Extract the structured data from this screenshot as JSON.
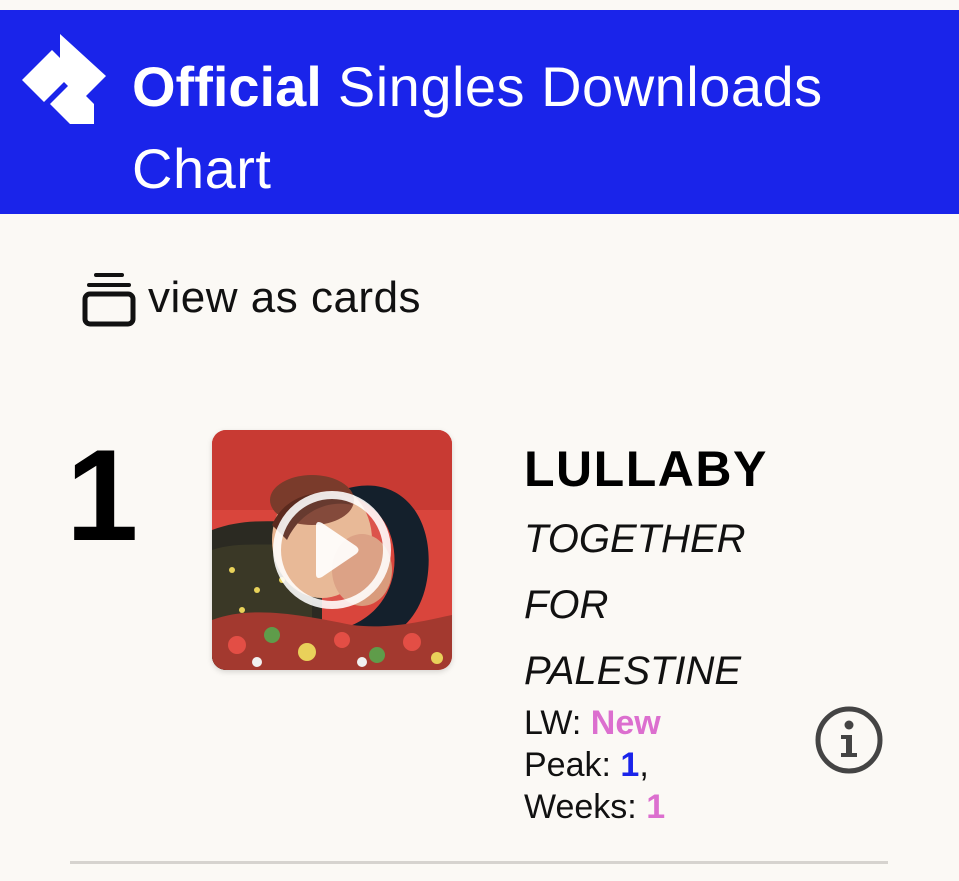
{
  "header": {
    "brand": "Official",
    "chart_name": "Singles Downloads Chart",
    "bg_color": "#1a24ea"
  },
  "view_toggle": {
    "label": "view as cards",
    "icon": "cards-stack-icon"
  },
  "entry": {
    "rank": "1",
    "title": "LULLABY",
    "artist_lines": [
      "TOGETHER",
      "FOR",
      "PALESTINE"
    ],
    "last_week_label": "LW:",
    "last_week_value": "New",
    "peak_label": "Peak:",
    "peak_value": "1",
    "peak_sep": ",",
    "weeks_label": "Weeks:",
    "weeks_value": "1",
    "play_icon": "play-icon",
    "info_icon": "info-icon"
  },
  "colors": {
    "accent_blue": "#1a24ea",
    "accent_pink": "#dc6fcf",
    "background": "#fbf9f5"
  }
}
